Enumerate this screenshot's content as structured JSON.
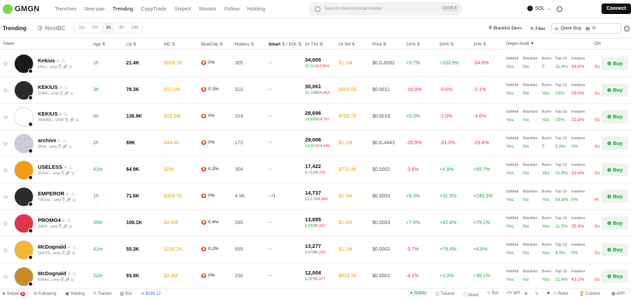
{
  "app": {
    "logo": "GMGN"
  },
  "nav": [
    "Trenches",
    "New pair",
    "Trending",
    "CopyTrade",
    "SnipeX",
    "Monitor",
    "Follow",
    "Holding"
  ],
  "search": {
    "placeholder": "Search token/contract/wallet",
    "shortcut": "Ctrl ⌘ K"
  },
  "chain": "SOL",
  "connect": "Connect",
  "tabs": {
    "trending": "Trending",
    "next": "NextBC"
  },
  "timeframes": [
    "1m",
    "5m",
    "1h",
    "6h",
    "24h"
  ],
  "blacklist_devs": "Blacklist Devs",
  "filter": "Filter",
  "quick_buy": {
    "label": "Quick Buy",
    "amount": "0"
  },
  "headers": {
    "token": "Token",
    "age": "Age",
    "liq": "Liq",
    "mc": "MC",
    "bluechip": "BlueChip",
    "holders": "Holders",
    "smart": "Smart",
    "kol": "/ KOL",
    "txs": "1h TXs",
    "vol": "1h Vol",
    "price": "Price",
    "p1m": "1m%",
    "p5m": "5m%",
    "p1h": "1h%",
    "degen": "Degen Audit",
    "dh": "DH"
  },
  "degen_labels": [
    "NoMint",
    "Blacklist",
    "Burnt",
    "Top 10",
    "Insiders"
  ],
  "rows": [
    {
      "name": "Kekius",
      "addr": "D5nJ...ump",
      "age": "1h",
      "liq": "21.4K",
      "mc": "$609.2K",
      "bc": "0%",
      "holders": "305",
      "smart": "--",
      "txs": "34,005",
      "buys": "20,111",
      "sells": "13,894",
      "vol": "$1.1M",
      "price": "$0.0₄6092",
      "p1m": "+9.7%",
      "p5m": "+333.9%",
      "p1h": "-64.6%",
      "d": [
        "Yes",
        "No",
        "?",
        "11.4%",
        "34.8%"
      ],
      "dh": "Sc"
    },
    {
      "name": "KEKIUS",
      "addr": "2rd5E...ump",
      "age": "3h",
      "liq": "78.3K",
      "mc": "$11.5M",
      "bc": "0.3%",
      "holders": "310",
      "smart": "--",
      "txs": "30,061",
      "buys": "15,108",
      "sells": "14,953",
      "vol": "$850.5K",
      "price": "$0.0011",
      "p1m": "-16.9%",
      "p5m": "-0.6%",
      "p1h": "-2.1%",
      "d": [
        "Yes",
        "No",
        "Yes",
        "10%",
        "29.8%"
      ],
      "dh": "Sc"
    },
    {
      "name": "KEKIUS",
      "addr": "4WMWc...UMP",
      "age": "4h",
      "liq": "136.9K",
      "mc": "$19.8M",
      "bc": "0%",
      "holders": "314",
      "smart": "--",
      "txs": "29,696",
      "buys": "14,899",
      "sells": "14,797",
      "vol": "$765.7K",
      "price": "$0.0019",
      "p1m": "+0.3%",
      "p5m": "-1.5%",
      "p1h": "-3.6%",
      "d": [
        "Yes",
        "No",
        "Yes",
        "10%",
        "32.8%"
      ],
      "dh": "Sc"
    },
    {
      "name": "archive",
      "addr": "2Kfsi...ump",
      "age": "2h",
      "liq": "69K",
      "mc": "$44.4K",
      "bc": "0%",
      "holders": "173",
      "smart": "--",
      "txs": "29,006",
      "buys": "14,557",
      "sells": "14,449",
      "vol": "$1.1M",
      "price": "$0.0₄4443",
      "p1m": "-29.9%",
      "p5m": "-31.3%",
      "p1h": "-29.4%",
      "d": [
        "Yes",
        "No",
        "?",
        "5.8%",
        "0%"
      ],
      "dh": "Sc"
    },
    {
      "name": "USELESS",
      "addr": "9hXkC...ump",
      "age": "41m",
      "liq": "64.9K",
      "mc": "$2M",
      "bc": "0.3%",
      "holders": "304",
      "smart": "--",
      "txs": "17,422",
      "buys": "8,721",
      "sells": "8,701",
      "vol": "$771.4K",
      "price": "$0.0002",
      "p1m": "-3.6%",
      "p5m": "+4.9%",
      "p1h": "+65.7%",
      "d": [
        "Yes",
        "No",
        "Yes",
        "11.9%",
        "32.6%"
      ],
      "dh": "Sc"
    },
    {
      "name": "EMPEROR",
      "addr": "7WJvG...ump",
      "age": "1h",
      "liq": "71.6K",
      "mc": "$359.7K",
      "bc": "0%",
      "holders": "4.9K",
      "smart": "--/1",
      "txs": "14,737",
      "buys": "10,279",
      "sells": "4,458",
      "vol": "$2.5M",
      "price": "$0.0003",
      "p1m": "+8.3%",
      "p5m": "+31.5%",
      "p1h": "+246.3%",
      "d": [
        "Yes",
        "No",
        "Yes",
        "54.8%",
        "0%"
      ],
      "dh": "Hi"
    },
    {
      "name": "PROMO4",
      "addr": "2dGF...ump",
      "age": "30m",
      "liq": "108.1K",
      "mc": "$3.5M",
      "bc": "0.4%",
      "holders": "285",
      "smart": "--",
      "txs": "13,895",
      "buys": "6,933",
      "sells": "6,962",
      "vol": "$1.8M",
      "price": "$0.0003",
      "p1m": "+7.9%",
      "p5m": "+42.4%",
      "p1h": "+79.1%",
      "d": [
        "Yes",
        "No",
        "Yes",
        "11.5%",
        "35.4%"
      ],
      "dh": "Sc"
    },
    {
      "name": "McDognald",
      "addr": "QbF5S...ump",
      "age": "41m",
      "liq": "55.3K",
      "mc": "$230.2K",
      "bc": "0.2%",
      "holders": "935",
      "smart": "--",
      "txs": "13,277",
      "buys": "6,978",
      "sells": "6,299",
      "vol": "$1.1M",
      "price": "$0.0002",
      "p1m": "-3.7%",
      "p5m": "+79.4%",
      "p1h": "+4.8%",
      "d": [
        "Yes",
        "No",
        "Yes",
        "4.9%",
        "0%"
      ],
      "dh": "Sc"
    },
    {
      "name": "McDognald",
      "addr": "8zHbo...ump",
      "age": "22m",
      "liq": "93.8K",
      "mc": "$2.8M",
      "bc": "0%",
      "holders": "290",
      "smart": "--",
      "txs": "12,004",
      "buys": "6,027",
      "sells": "5,977",
      "vol": "$628.5K",
      "price": "$0.0002",
      "p1m": "-4.2%",
      "p5m": "+3.3%",
      "p1h": "+36.1%",
      "d": [
        "Yes",
        "No",
        "Yes",
        "11.4%",
        "43.2%"
      ],
      "dh": "Sc"
    }
  ],
  "buy_label": "Buy",
  "footer": {
    "sniper": "Sniper",
    "following": "Following",
    "holding": "Holding",
    "tracker": "Tracker",
    "pnl": "PnL",
    "balance": "$188.12",
    "stable": "Stable",
    "tutorial": "Tutorial",
    "about": "About",
    "bot": "Bot",
    "api": "API",
    "refer": "Refer",
    "contest": "Contest",
    "app": "APP"
  }
}
